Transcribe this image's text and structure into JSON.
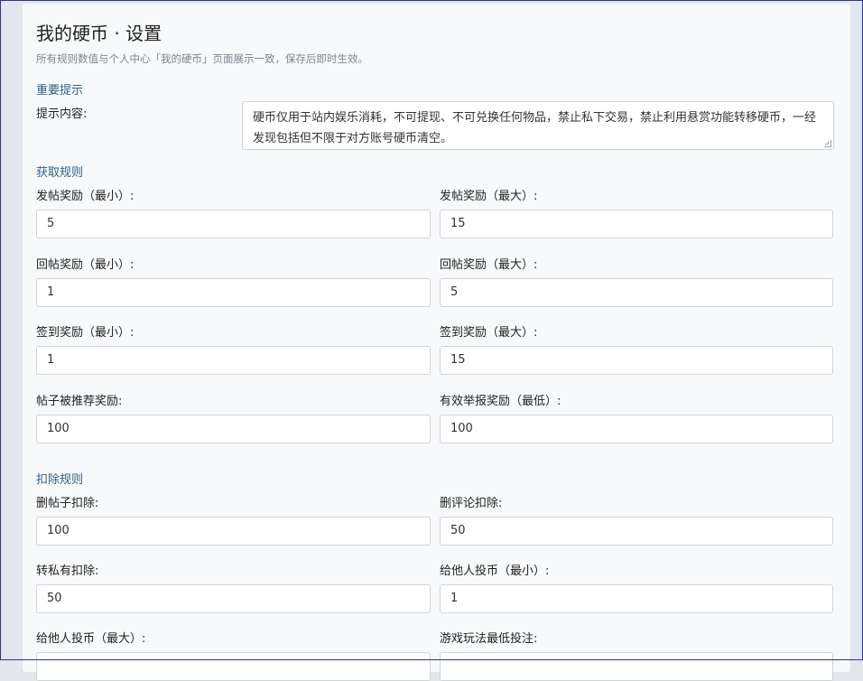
{
  "header": {
    "title": "我的硬币 · 设置",
    "subtitle": "所有规则数值与个人中心「我的硬币」页面展示一致，保存后即时生效。"
  },
  "notice": {
    "section_title": "重要提示",
    "label": "提示内容:",
    "content": "硬币仅用于站内娱乐消耗，不可提现、不可兑换任何物品，禁止私下交易，禁止利用悬赏功能转移硬币，一经发现包括但不限于对方账号硬币清空。"
  },
  "earn": {
    "section_title": "获取规则",
    "fields": [
      {
        "label": "发帖奖励（最小）:",
        "value": "5"
      },
      {
        "label": "发帖奖励（最大）:",
        "value": "15"
      },
      {
        "label": "回帖奖励（最小）:",
        "value": "1"
      },
      {
        "label": "回帖奖励（最大）:",
        "value": "5"
      },
      {
        "label": "签到奖励（最小）:",
        "value": "1"
      },
      {
        "label": "签到奖励（最大）:",
        "value": "15"
      },
      {
        "label": "帖子被推荐奖励:",
        "value": "100"
      },
      {
        "label": "有效举报奖励（最低）:",
        "value": "100"
      }
    ]
  },
  "deduct": {
    "section_title": "扣除规则",
    "fields": [
      {
        "label": "删帖子扣除:",
        "value": "100"
      },
      {
        "label": "删评论扣除:",
        "value": "50"
      },
      {
        "label": "转私有扣除:",
        "value": "50"
      },
      {
        "label": "给他人投币（最小）:",
        "value": "1"
      },
      {
        "label": "给他人投币（最大）:",
        "value": ""
      },
      {
        "label": "游戏玩法最低投注:",
        "value": ""
      }
    ]
  }
}
